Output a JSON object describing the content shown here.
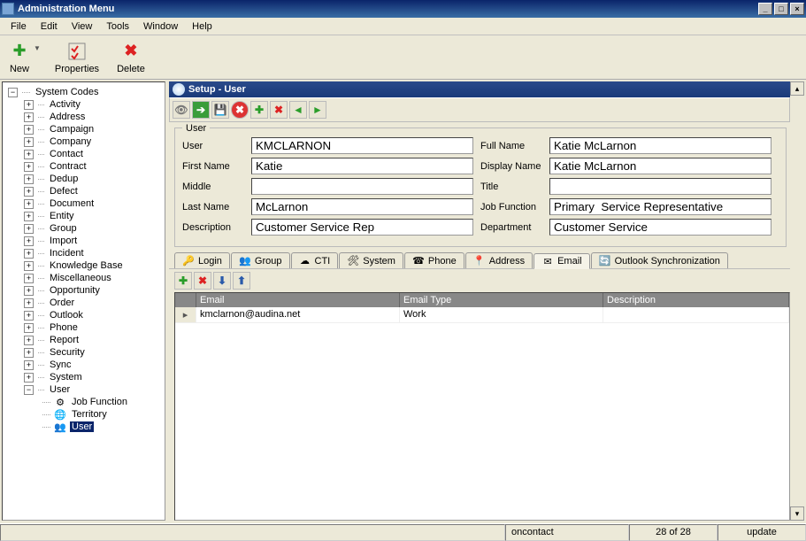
{
  "window": {
    "title": "Administration Menu"
  },
  "menu": [
    "File",
    "Edit",
    "View",
    "Tools",
    "Window",
    "Help"
  ],
  "toolbar": [
    {
      "label": "New",
      "icon": "plus",
      "color": "#2a9d2a",
      "dropdown": true
    },
    {
      "label": "Properties",
      "icon": "check",
      "color": "#d22"
    },
    {
      "label": "Delete",
      "icon": "x",
      "color": "#d22"
    }
  ],
  "tree": {
    "root": {
      "label": "System Codes",
      "expanded": true
    },
    "nodes": [
      "Activity",
      "Address",
      "Campaign",
      "Company",
      "Contact",
      "Contract",
      "Dedup",
      "Defect",
      "Document",
      "Entity",
      "Group",
      "Import",
      "Incident",
      "Knowledge Base",
      "Miscellaneous",
      "Opportunity",
      "Order",
      "Outlook",
      "Phone",
      "Report",
      "Security",
      "Sync",
      "System"
    ],
    "user": {
      "label": "User",
      "children": [
        {
          "label": "Job Function",
          "icon": "gear"
        },
        {
          "label": "Territory",
          "icon": "globe"
        },
        {
          "label": "User",
          "icon": "people",
          "selected": true
        }
      ]
    }
  },
  "pane": {
    "title": "Setup - User"
  },
  "form": {
    "legend": "User",
    "fields": {
      "user_l": "User",
      "user_v": "KMCLARNON",
      "fullname_l": "Full Name",
      "fullname_v": "Katie McLarnon",
      "first_l": "First Name",
      "first_v": "Katie",
      "display_l": "Display Name",
      "display_v": "Katie McLarnon",
      "middle_l": "Middle",
      "middle_v": "",
      "title_l": "Title",
      "title_v": "",
      "last_l": "Last Name",
      "last_v": "McLarnon",
      "job_l": "Job Function",
      "job_v": "Primary  Service Representative",
      "desc_l": "Description",
      "desc_v": "Customer Service Rep",
      "dept_l": "Department",
      "dept_v": "Customer Service"
    }
  },
  "tabs": [
    {
      "label": "Login",
      "icon": "key"
    },
    {
      "label": "Group",
      "icon": "people"
    },
    {
      "label": "CTI",
      "icon": "cloud"
    },
    {
      "label": "System",
      "icon": "tools"
    },
    {
      "label": "Phone",
      "icon": "phone"
    },
    {
      "label": "Address",
      "icon": "pin"
    },
    {
      "label": "Email",
      "icon": "mail",
      "active": true
    },
    {
      "label": "Outlook Synchronization",
      "icon": "sync"
    }
  ],
  "grid": {
    "headers": {
      "email": "Email",
      "type": "Email Type",
      "desc": "Description"
    },
    "rows": [
      {
        "email": "kmclarnon@audina.net",
        "type": "Work",
        "desc": ""
      }
    ]
  },
  "status": {
    "s2": "oncontact",
    "s3": "28 of 28",
    "s4": "update"
  }
}
